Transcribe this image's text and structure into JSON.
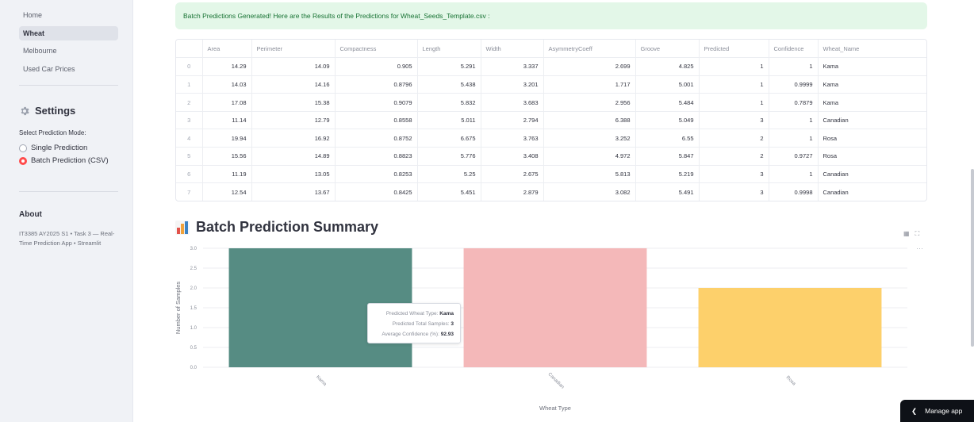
{
  "sidebar": {
    "nav": [
      "Home",
      "Wheat",
      "Melbourne",
      "Used Car Prices"
    ],
    "active_index": 1,
    "settings_title": "Settings",
    "mode_label": "Select Prediction Mode:",
    "modes": [
      "Single Prediction",
      "Batch Prediction (CSV)"
    ],
    "selected_mode": "Batch Prediction (CSV)",
    "about_title": "About",
    "about_text": "IT3385 AY2025 S1 • Task 3 — Real-Time Prediction App • Streamlit"
  },
  "alert": {
    "text": "Batch Predictions Generated! Here are the Results of the Predictions for Wheat_Seeds_Template.csv :"
  },
  "table": {
    "columns": [
      "",
      "Area",
      "Perimeter",
      "Compactness",
      "Length",
      "Width",
      "AsymmetryCoeff",
      "Groove",
      "Predicted",
      "Confidence",
      "Wheat_Name"
    ],
    "rows": [
      [
        "0",
        "14.29",
        "14.09",
        "0.905",
        "5.291",
        "3.337",
        "2.699",
        "4.825",
        "1",
        "1",
        "Kama"
      ],
      [
        "1",
        "14.03",
        "14.16",
        "0.8796",
        "5.438",
        "3.201",
        "1.717",
        "5.001",
        "1",
        "0.9999",
        "Kama"
      ],
      [
        "2",
        "17.08",
        "15.38",
        "0.9079",
        "5.832",
        "3.683",
        "2.956",
        "5.484",
        "1",
        "0.7879",
        "Kama"
      ],
      [
        "3",
        "11.14",
        "12.79",
        "0.8558",
        "5.011",
        "2.794",
        "6.388",
        "5.049",
        "3",
        "1",
        "Canadian"
      ],
      [
        "4",
        "19.94",
        "16.92",
        "0.8752",
        "6.675",
        "3.763",
        "3.252",
        "6.55",
        "2",
        "1",
        "Rosa"
      ],
      [
        "5",
        "15.56",
        "14.89",
        "0.8823",
        "5.776",
        "3.408",
        "4.972",
        "5.847",
        "2",
        "0.9727",
        "Rosa"
      ],
      [
        "6",
        "11.19",
        "13.05",
        "0.8253",
        "5.25",
        "2.675",
        "5.813",
        "5.219",
        "3",
        "1",
        "Canadian"
      ],
      [
        "7",
        "12.54",
        "13.67",
        "0.8425",
        "5.451",
        "2.879",
        "3.082",
        "5.491",
        "3",
        "0.9998",
        "Canadian"
      ]
    ]
  },
  "summary": {
    "title": "Batch Prediction Summary"
  },
  "chart_data": {
    "type": "bar",
    "title": "",
    "categories": [
      "Kama",
      "Canadian",
      "Rosa"
    ],
    "values": [
      3,
      3,
      2
    ],
    "colors": [
      "#568c83",
      "#f4b8b9",
      "#fdd06b"
    ],
    "xlabel": "Wheat Type",
    "ylabel": "Number of Samples",
    "ylim": [
      0,
      3
    ],
    "yticks": [
      "0.0",
      "0.5",
      "1.0",
      "1.5",
      "2.0",
      "2.5",
      "3.0"
    ],
    "grid": true,
    "tooltip": {
      "rows": [
        [
          "Predicted Wheat Type:",
          "Kama"
        ],
        [
          "Predicted Total Samples:",
          "3"
        ],
        [
          "Average Confidence (%):",
          "92.93"
        ]
      ]
    }
  },
  "manage_app": {
    "label": "Manage app"
  }
}
